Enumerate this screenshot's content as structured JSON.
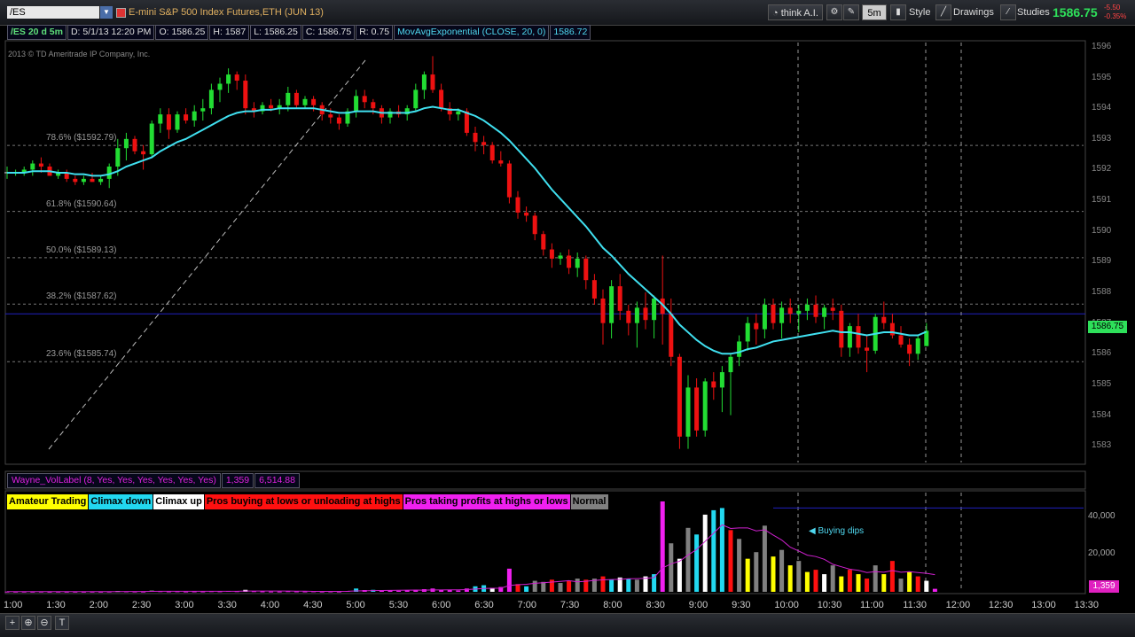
{
  "toolbar": {
    "symbol": "/ES",
    "instrument_title": "E-mini S&P 500 Index Futures,ETH (JUN 13)",
    "think_ai": "think A.I.",
    "interval": "5m",
    "style": "Style",
    "drawings": "Drawings",
    "studies": "Studies",
    "last_price": "1586.75",
    "change_1": "-5.50",
    "change_2": "-0.35%"
  },
  "infobar": {
    "symbol_period": "/ES 20 d 5m",
    "date": "D: 5/1/13 12:20 PM",
    "open": "O: 1586.25",
    "high": "H: 1587",
    "low": "L: 1586.25",
    "close": "C: 1586.75",
    "range": "R: 0.75",
    "ema_label": "MovAvgExponential (CLOSE, 20, 0)",
    "ema_value": "1586.72"
  },
  "copyright": "2013 © TD Ameritrade IP Company, Inc.",
  "fib_levels": [
    {
      "label": "78.6%  ($1592.79)",
      "price": 1592.79
    },
    {
      "label": "61.8%  ($1590.64)",
      "price": 1590.64
    },
    {
      "label": "50.0%  ($1589.13)",
      "price": 1589.13
    },
    {
      "label": "38.2%  ($1587.62)",
      "price": 1587.62
    },
    {
      "label": "23.6%  ($1585.74)",
      "price": 1585.74
    }
  ],
  "price_axis": [
    "1596",
    "1595",
    "1594",
    "1593",
    "1592",
    "1591",
    "1590",
    "1589",
    "1588",
    "1587",
    "1586",
    "1585",
    "1584",
    "1583"
  ],
  "current_price_label": "1586.75",
  "time_axis": [
    "1:00",
    "1:30",
    "2:00",
    "2:30",
    "3:00",
    "3:30",
    "4:00",
    "4:30",
    "5:00",
    "5:30",
    "6:00",
    "6:30",
    "7:00",
    "7:30",
    "8:00",
    "8:30",
    "9:00",
    "9:30",
    "10:00",
    "10:30",
    "11:00",
    "11:30",
    "12:00",
    "12:30",
    "13:00",
    "13:30"
  ],
  "volume_study": {
    "name": "Wayne_VolLabel (8, Yes, Yes, Yes, Yes, Yes, Yes)",
    "value_1": "1,359",
    "value_2": "6,514.88",
    "axis": [
      "40,000",
      "20,000"
    ],
    "current": "1,359",
    "annotation": "Buying dips"
  },
  "legend": [
    {
      "label": "Amateur Trading",
      "bg": "#ffff00",
      "fg": "#000000"
    },
    {
      "label": "Climax down",
      "bg": "#22d8f0",
      "fg": "#000000"
    },
    {
      "label": "Climax up",
      "bg": "#ffffff",
      "fg": "#000000"
    },
    {
      "label": "Pros buying at lows or unloading at highs",
      "bg": "#ff1010",
      "fg": "#000000"
    },
    {
      "label": "Pros taking profits at highs or lows",
      "bg": "#f020f0",
      "fg": "#000000"
    },
    {
      "label": "Normal",
      "bg": "#808080",
      "fg": "#000000"
    }
  ],
  "colors": {
    "up": "#22dd33",
    "down": "#ee1111",
    "ema": "#40e0f0",
    "grid": "#666666"
  },
  "chart_data": {
    "type": "candlestick",
    "candles": [
      [
        1591.9,
        1592.1,
        1591.7,
        1591.9
      ],
      [
        1591.9,
        1592.0,
        1591.8,
        1591.9
      ],
      [
        1591.9,
        1592.1,
        1591.8,
        1592.0
      ],
      [
        1592.0,
        1592.3,
        1591.8,
        1592.2
      ],
      [
        1592.2,
        1592.4,
        1591.9,
        1592.1
      ],
      [
        1592.1,
        1592.2,
        1591.8,
        1591.8
      ],
      [
        1591.8,
        1592.0,
        1591.7,
        1591.9
      ],
      [
        1591.9,
        1592.0,
        1591.6,
        1591.7
      ],
      [
        1591.7,
        1591.8,
        1591.5,
        1591.6
      ],
      [
        1591.6,
        1591.8,
        1591.5,
        1591.7
      ],
      [
        1591.7,
        1591.9,
        1591.6,
        1591.6
      ],
      [
        1591.6,
        1591.8,
        1591.5,
        1591.7
      ],
      [
        1591.7,
        1592.2,
        1591.4,
        1592.1
      ],
      [
        1592.1,
        1593.0,
        1591.8,
        1592.7
      ],
      [
        1592.7,
        1593.2,
        1592.3,
        1593.0
      ],
      [
        1593.0,
        1593.1,
        1592.5,
        1592.6
      ],
      [
        1592.6,
        1592.8,
        1592.0,
        1592.5
      ],
      [
        1592.5,
        1593.6,
        1592.4,
        1593.5
      ],
      [
        1593.5,
        1594.0,
        1593.2,
        1593.8
      ],
      [
        1593.8,
        1594.0,
        1593.0,
        1593.3
      ],
      [
        1593.3,
        1593.9,
        1593.2,
        1593.8
      ],
      [
        1593.8,
        1594.0,
        1593.5,
        1593.6
      ],
      [
        1593.6,
        1594.1,
        1593.4,
        1593.9
      ],
      [
        1593.9,
        1594.3,
        1593.6,
        1594.0
      ],
      [
        1594.0,
        1594.8,
        1593.8,
        1594.6
      ],
      [
        1594.6,
        1595.0,
        1594.2,
        1594.8
      ],
      [
        1594.8,
        1595.3,
        1594.5,
        1595.1
      ],
      [
        1595.1,
        1595.2,
        1594.6,
        1594.9
      ],
      [
        1594.9,
        1595.1,
        1593.8,
        1594.0
      ],
      [
        1594.0,
        1594.2,
        1593.7,
        1593.9
      ],
      [
        1593.9,
        1594.2,
        1593.8,
        1594.1
      ],
      [
        1594.1,
        1594.3,
        1593.9,
        1594.0
      ],
      [
        1594.0,
        1594.3,
        1593.8,
        1594.1
      ],
      [
        1594.1,
        1594.7,
        1593.9,
        1594.5
      ],
      [
        1594.5,
        1594.6,
        1594.0,
        1594.1
      ],
      [
        1594.1,
        1594.4,
        1594.0,
        1594.3
      ],
      [
        1594.3,
        1594.4,
        1593.9,
        1594.1
      ],
      [
        1594.1,
        1594.2,
        1593.6,
        1593.8
      ],
      [
        1593.8,
        1594.0,
        1593.5,
        1593.7
      ],
      [
        1593.7,
        1593.8,
        1593.3,
        1593.5
      ],
      [
        1593.5,
        1594.0,
        1593.4,
        1593.9
      ],
      [
        1593.9,
        1594.6,
        1593.7,
        1594.4
      ],
      [
        1594.4,
        1594.6,
        1594.0,
        1594.2
      ],
      [
        1594.2,
        1594.3,
        1593.8,
        1594.0
      ],
      [
        1594.0,
        1594.1,
        1593.5,
        1593.7
      ],
      [
        1593.7,
        1594.0,
        1593.5,
        1593.9
      ],
      [
        1593.9,
        1594.1,
        1593.7,
        1593.8
      ],
      [
        1593.8,
        1594.1,
        1593.6,
        1594.0
      ],
      [
        1594.0,
        1594.8,
        1593.9,
        1594.6
      ],
      [
        1594.6,
        1595.2,
        1594.3,
        1595.1
      ],
      [
        1595.1,
        1595.7,
        1594.5,
        1594.6
      ],
      [
        1594.6,
        1594.8,
        1593.9,
        1594.0
      ],
      [
        1594.0,
        1594.2,
        1593.6,
        1593.8
      ],
      [
        1593.8,
        1594.0,
        1593.6,
        1593.9
      ],
      [
        1593.9,
        1594.0,
        1593.1,
        1593.2
      ],
      [
        1593.2,
        1593.4,
        1592.6,
        1592.9
      ],
      [
        1592.9,
        1593.1,
        1592.5,
        1592.8
      ],
      [
        1592.8,
        1592.9,
        1592.2,
        1592.3
      ],
      [
        1592.3,
        1592.6,
        1592.1,
        1592.2
      ],
      [
        1592.2,
        1592.3,
        1590.9,
        1591.1
      ],
      [
        1591.1,
        1591.3,
        1590.4,
        1590.6
      ],
      [
        1590.6,
        1590.8,
        1590.3,
        1590.5
      ],
      [
        1590.5,
        1590.6,
        1589.7,
        1589.9
      ],
      [
        1589.9,
        1590.0,
        1589.2,
        1589.4
      ],
      [
        1589.4,
        1589.6,
        1588.8,
        1589.1
      ],
      [
        1589.1,
        1589.3,
        1588.9,
        1589.2
      ],
      [
        1589.2,
        1589.4,
        1588.6,
        1588.8
      ],
      [
        1588.8,
        1589.3,
        1588.5,
        1589.1
      ],
      [
        1589.1,
        1589.2,
        1588.1,
        1588.4
      ],
      [
        1588.4,
        1588.6,
        1587.6,
        1587.8
      ],
      [
        1587.8,
        1588.1,
        1586.3,
        1587.0
      ],
      [
        1587.0,
        1588.4,
        1586.5,
        1588.2
      ],
      [
        1588.2,
        1588.6,
        1587.1,
        1587.4
      ],
      [
        1587.4,
        1587.6,
        1586.6,
        1587.0
      ],
      [
        1587.0,
        1587.7,
        1586.2,
        1587.5
      ],
      [
        1587.5,
        1588.0,
        1586.8,
        1587.1
      ],
      [
        1587.1,
        1587.9,
        1586.5,
        1587.8
      ],
      [
        1587.8,
        1589.2,
        1586.3,
        1587.3
      ],
      [
        1587.3,
        1587.8,
        1585.6,
        1585.9
      ],
      [
        1585.9,
        1586.0,
        1582.9,
        1583.3
      ],
      [
        1583.3,
        1585.3,
        1582.9,
        1584.9
      ],
      [
        1584.9,
        1585.2,
        1583.3,
        1583.5
      ],
      [
        1583.5,
        1585.2,
        1583.3,
        1585.1
      ],
      [
        1585.1,
        1585.4,
        1584.5,
        1584.9
      ],
      [
        1584.9,
        1585.6,
        1584.1,
        1585.4
      ],
      [
        1585.4,
        1586.0,
        1584.0,
        1585.9
      ],
      [
        1585.9,
        1586.6,
        1585.6,
        1586.4
      ],
      [
        1586.4,
        1587.2,
        1586.1,
        1587.0
      ],
      [
        1587.0,
        1587.3,
        1586.3,
        1586.8
      ],
      [
        1586.8,
        1587.8,
        1586.5,
        1587.6
      ],
      [
        1587.6,
        1587.8,
        1586.8,
        1587.0
      ],
      [
        1587.0,
        1587.7,
        1586.5,
        1587.5
      ],
      [
        1587.5,
        1587.8,
        1587.0,
        1587.3
      ],
      [
        1587.3,
        1587.6,
        1586.7,
        1587.4
      ],
      [
        1587.4,
        1587.8,
        1587.1,
        1587.6
      ],
      [
        1587.6,
        1587.9,
        1587.0,
        1587.2
      ],
      [
        1587.2,
        1587.6,
        1586.8,
        1587.5
      ],
      [
        1587.5,
        1587.8,
        1587.1,
        1587.4
      ],
      [
        1587.4,
        1587.6,
        1585.9,
        1586.2
      ],
      [
        1586.2,
        1587.0,
        1585.9,
        1586.9
      ],
      [
        1586.9,
        1587.3,
        1586.0,
        1586.2
      ],
      [
        1586.2,
        1586.6,
        1585.4,
        1586.1
      ],
      [
        1586.1,
        1587.3,
        1586.0,
        1587.2
      ],
      [
        1587.2,
        1587.7,
        1586.8,
        1587.0
      ],
      [
        1587.0,
        1587.3,
        1586.5,
        1586.6
      ],
      [
        1586.6,
        1586.9,
        1586.2,
        1586.3
      ],
      [
        1586.3,
        1586.5,
        1585.6,
        1586.0
      ],
      [
        1586.0,
        1586.6,
        1585.8,
        1586.5
      ],
      [
        1586.25,
        1587.0,
        1586.25,
        1586.75
      ]
    ],
    "ema": [
      1591.9,
      1591.9,
      1591.9,
      1591.95,
      1591.95,
      1591.95,
      1591.9,
      1591.9,
      1591.85,
      1591.85,
      1591.8,
      1591.8,
      1591.85,
      1591.95,
      1592.1,
      1592.2,
      1592.3,
      1592.4,
      1592.6,
      1592.75,
      1592.9,
      1593.0,
      1593.15,
      1593.3,
      1593.45,
      1593.6,
      1593.75,
      1593.85,
      1593.9,
      1593.9,
      1593.95,
      1593.95,
      1594.0,
      1594.0,
      1594.0,
      1594.0,
      1594.0,
      1593.95,
      1593.9,
      1593.85,
      1593.85,
      1593.9,
      1593.9,
      1593.9,
      1593.85,
      1593.85,
      1593.85,
      1593.85,
      1593.9,
      1594.0,
      1594.05,
      1594.0,
      1593.95,
      1593.95,
      1593.85,
      1593.75,
      1593.6,
      1593.4,
      1593.2,
      1592.95,
      1592.65,
      1592.35,
      1592.05,
      1591.7,
      1591.35,
      1591.05,
      1590.75,
      1590.45,
      1590.15,
      1589.8,
      1589.45,
      1589.2,
      1588.9,
      1588.6,
      1588.35,
      1588.1,
      1587.85,
      1587.6,
      1587.3,
      1586.95,
      1586.7,
      1586.45,
      1586.25,
      1586.1,
      1586.0,
      1586.0,
      1586.05,
      1586.15,
      1586.2,
      1586.3,
      1586.4,
      1586.45,
      1586.5,
      1586.55,
      1586.6,
      1586.65,
      1586.7,
      1586.75,
      1586.7,
      1586.7,
      1586.65,
      1586.6,
      1586.65,
      1586.7,
      1586.7,
      1586.65,
      1586.6,
      1586.6,
      1586.72
    ],
    "y_range": [
      1582.4,
      1596.2
    ],
    "current_price": 1586.75,
    "volume": [
      [
        120,
        "m"
      ],
      [
        90,
        "m"
      ],
      [
        100,
        "m"
      ],
      [
        80,
        "m"
      ],
      [
        110,
        "m"
      ],
      [
        60,
        "m"
      ],
      [
        90,
        "m"
      ],
      [
        70,
        "m"
      ],
      [
        80,
        "m"
      ],
      [
        60,
        "m"
      ],
      [
        90,
        "m"
      ],
      [
        70,
        "m"
      ],
      [
        120,
        "m"
      ],
      [
        350,
        "w"
      ],
      [
        200,
        "m"
      ],
      [
        150,
        "m"
      ],
      [
        120,
        "m"
      ],
      [
        500,
        "w"
      ],
      [
        300,
        "m"
      ],
      [
        200,
        "m"
      ],
      [
        250,
        "m"
      ],
      [
        150,
        "m"
      ],
      [
        200,
        "m"
      ],
      [
        180,
        "m"
      ],
      [
        300,
        "m"
      ],
      [
        250,
        "m"
      ],
      [
        400,
        "m"
      ],
      [
        300,
        "m"
      ],
      [
        900,
        "w"
      ],
      [
        300,
        "m"
      ],
      [
        200,
        "m"
      ],
      [
        150,
        "m"
      ],
      [
        150,
        "m"
      ],
      [
        300,
        "m"
      ],
      [
        200,
        "m"
      ],
      [
        180,
        "m"
      ],
      [
        250,
        "m"
      ],
      [
        150,
        "m"
      ],
      [
        200,
        "m"
      ],
      [
        150,
        "m"
      ],
      [
        400,
        "m"
      ],
      [
        1500,
        "c"
      ],
      [
        800,
        "m"
      ],
      [
        900,
        "c"
      ],
      [
        600,
        "m"
      ],
      [
        700,
        "m"
      ],
      [
        500,
        "m"
      ],
      [
        600,
        "m"
      ],
      [
        900,
        "m"
      ],
      [
        1200,
        "m"
      ],
      [
        1500,
        "m"
      ],
      [
        1000,
        "m"
      ],
      [
        800,
        "m"
      ],
      [
        600,
        "m"
      ],
      [
        1500,
        "m"
      ],
      [
        2500,
        "c"
      ],
      [
        3000,
        "c"
      ],
      [
        1800,
        "w"
      ],
      [
        2200,
        "m"
      ],
      [
        10500,
        "m"
      ],
      [
        3500,
        "r"
      ],
      [
        2500,
        "c"
      ],
      [
        5000,
        "g"
      ],
      [
        4500,
        "g"
      ],
      [
        5500,
        "r"
      ],
      [
        4000,
        "g"
      ],
      [
        5000,
        "r"
      ],
      [
        6000,
        "g"
      ],
      [
        5500,
        "r"
      ],
      [
        6000,
        "g"
      ],
      [
        7000,
        "r"
      ],
      [
        5500,
        "c"
      ],
      [
        6500,
        "w"
      ],
      [
        6000,
        "c"
      ],
      [
        5500,
        "g"
      ],
      [
        7000,
        "w"
      ],
      [
        8000,
        "c"
      ],
      [
        41000,
        "m"
      ],
      [
        22000,
        "g"
      ],
      [
        15000,
        "w"
      ],
      [
        29000,
        "g"
      ],
      [
        26000,
        "c"
      ],
      [
        35000,
        "w"
      ],
      [
        37000,
        "c"
      ],
      [
        38000,
        "c"
      ],
      [
        28000,
        "r"
      ],
      [
        24000,
        "g"
      ],
      [
        15000,
        "y"
      ],
      [
        18000,
        "g"
      ],
      [
        30000,
        "g"
      ],
      [
        16000,
        "y"
      ],
      [
        19000,
        "g"
      ],
      [
        12000,
        "y"
      ],
      [
        14000,
        "g"
      ],
      [
        9000,
        "y"
      ],
      [
        10000,
        "r"
      ],
      [
        8000,
        "w"
      ],
      [
        12000,
        "g"
      ],
      [
        7000,
        "y"
      ],
      [
        10000,
        "r"
      ],
      [
        8000,
        "y"
      ],
      [
        6000,
        "r"
      ],
      [
        12000,
        "g"
      ],
      [
        8000,
        "y"
      ],
      [
        14000,
        "r"
      ],
      [
        6000,
        "g"
      ],
      [
        9000,
        "y"
      ],
      [
        7000,
        "r"
      ],
      [
        5000,
        "w"
      ],
      [
        1359,
        "m"
      ]
    ],
    "volume_color_key": {
      "y": "Amateur Trading",
      "c": "Climax down",
      "w": "Climax up",
      "r": "Pros buying at lows or unloading at highs",
      "m": "Pros taking profits at highs or lows",
      "g": "Normal"
    },
    "volume_y_max": 45000,
    "volume_reference_line": 38000
  },
  "bottom_tools": [
    "+",
    "⊕",
    "⊖",
    "T"
  ]
}
